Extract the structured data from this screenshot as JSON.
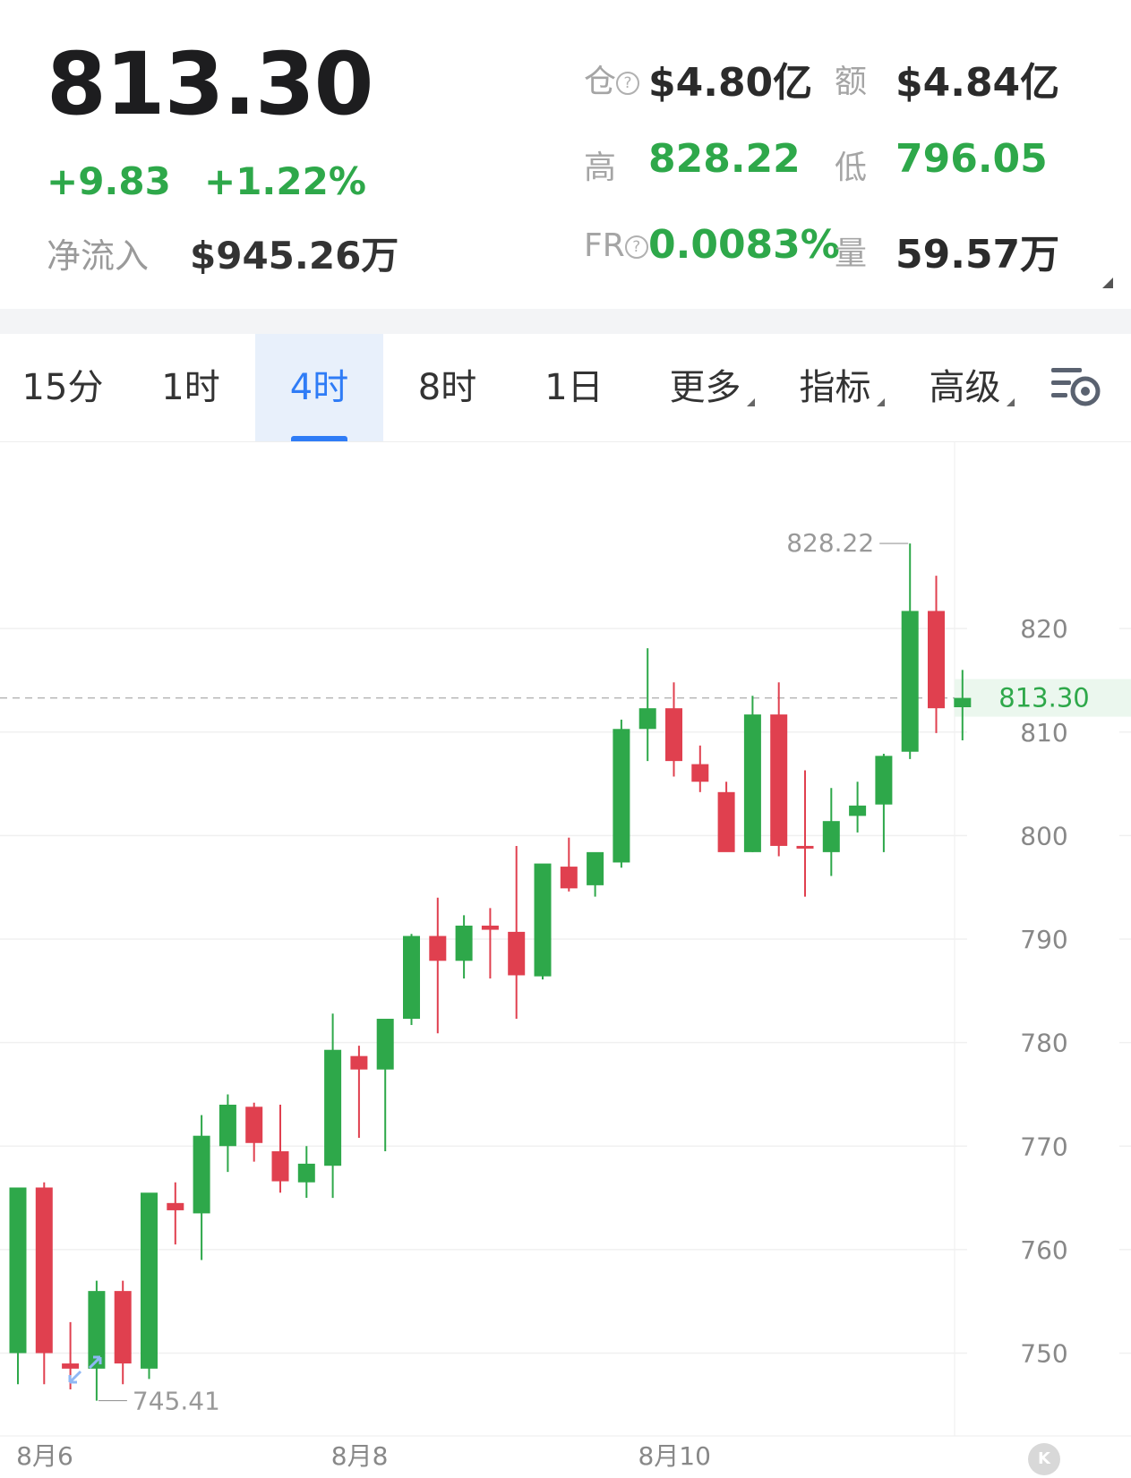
{
  "header": {
    "price": "813.30",
    "change": "+9.83",
    "change_pct": "+1.22%",
    "inflow_label": "净流入",
    "inflow_value": "$945.26万",
    "oi_label": "仓",
    "oi_value": "$4.80亿",
    "amount_label": "额",
    "amount_value": "$4.84亿",
    "high_label": "高",
    "high_value": "828.22",
    "low_label": "低",
    "low_value": "796.05",
    "fr_label": "FR",
    "fr_value": "0.0083%",
    "volume_label": "量",
    "volume_value": "59.57万",
    "help_icon": "question-circle-icon"
  },
  "tabs": [
    {
      "label": "15分",
      "active": false
    },
    {
      "label": "1时",
      "active": false
    },
    {
      "label": "4时",
      "active": true
    },
    {
      "label": "8时",
      "active": false
    },
    {
      "label": "1日",
      "active": false
    },
    {
      "label": "更多",
      "dropdown": true
    },
    {
      "label": "指标",
      "dropdown": true
    },
    {
      "label": "高级",
      "dropdown": true
    }
  ],
  "settings_icon": "chart-settings-icon",
  "colors": {
    "up": "#2ea84a",
    "down": "#e0404f",
    "accent": "#2f7cf6"
  },
  "chart_data": {
    "type": "candlestick",
    "interval": "4时",
    "ylim": [
      742,
      838
    ],
    "yticks": [
      750,
      760,
      770,
      780,
      790,
      800,
      810,
      820
    ],
    "xticks": [
      {
        "label": "8月6",
        "index": 0
      },
      {
        "label": "8月8",
        "index": 12
      },
      {
        "label": "8月10",
        "index": 24
      }
    ],
    "last_price": 813.3,
    "last_price_label": "813.30",
    "max_marker": {
      "label": "828.22",
      "value": 828.22
    },
    "min_marker": {
      "label": "745.41",
      "value": 745.41
    },
    "candles": [
      {
        "o": 750.0,
        "h": 766.0,
        "l": 747.0,
        "c": 766.0
      },
      {
        "o": 766.0,
        "h": 766.5,
        "l": 747.0,
        "c": 750.0
      },
      {
        "o": 749.0,
        "h": 753.0,
        "l": 746.5,
        "c": 748.5
      },
      {
        "o": 748.5,
        "h": 757.0,
        "l": 745.41,
        "c": 756.0
      },
      {
        "o": 756.0,
        "h": 757.0,
        "l": 747.0,
        "c": 749.0
      },
      {
        "o": 748.5,
        "h": 764.0,
        "l": 747.5,
        "c": 765.5
      },
      {
        "o": 764.5,
        "h": 766.5,
        "l": 760.5,
        "c": 763.8
      },
      {
        "o": 763.5,
        "h": 773.0,
        "l": 759.0,
        "c": 771.0
      },
      {
        "o": 770.0,
        "h": 775.0,
        "l": 767.5,
        "c": 774.0
      },
      {
        "o": 773.8,
        "h": 774.2,
        "l": 768.5,
        "c": 770.3
      },
      {
        "o": 769.5,
        "h": 774.0,
        "l": 765.5,
        "c": 766.6
      },
      {
        "o": 766.5,
        "h": 770.0,
        "l": 765.0,
        "c": 768.3
      },
      {
        "o": 768.1,
        "h": 782.8,
        "l": 765.0,
        "c": 779.3
      },
      {
        "o": 778.7,
        "h": 779.7,
        "l": 770.8,
        "c": 777.4
      },
      {
        "o": 777.4,
        "h": 782.2,
        "l": 769.5,
        "c": 782.3
      },
      {
        "o": 782.3,
        "h": 790.5,
        "l": 781.7,
        "c": 790.3
      },
      {
        "o": 790.3,
        "h": 794.0,
        "l": 780.9,
        "c": 787.9
      },
      {
        "o": 787.9,
        "h": 792.3,
        "l": 786.2,
        "c": 791.3
      },
      {
        "o": 791.3,
        "h": 793.0,
        "l": 786.2,
        "c": 790.9
      },
      {
        "o": 790.7,
        "h": 799.0,
        "l": 782.3,
        "c": 786.5
      },
      {
        "o": 786.4,
        "h": 796.5,
        "l": 786.1,
        "c": 797.3
      },
      {
        "o": 797.0,
        "h": 799.8,
        "l": 794.6,
        "c": 794.9
      },
      {
        "o": 795.2,
        "h": 797.3,
        "l": 794.1,
        "c": 798.4
      },
      {
        "o": 797.4,
        "h": 811.2,
        "l": 796.9,
        "c": 810.3
      },
      {
        "o": 810.3,
        "h": 818.1,
        "l": 807.2,
        "c": 812.3
      },
      {
        "o": 812.3,
        "h": 814.8,
        "l": 805.7,
        "c": 807.2
      },
      {
        "o": 806.9,
        "h": 808.7,
        "l": 804.2,
        "c": 805.2
      },
      {
        "o": 804.2,
        "h": 805.2,
        "l": 798.7,
        "c": 798.4
      },
      {
        "o": 798.4,
        "h": 813.5,
        "l": 798.4,
        "c": 811.7
      },
      {
        "o": 811.7,
        "h": 814.8,
        "l": 798.0,
        "c": 799.0
      },
      {
        "o": 799.0,
        "h": 806.3,
        "l": 794.1,
        "c": 798.8
      },
      {
        "o": 798.4,
        "h": 804.6,
        "l": 796.1,
        "c": 801.4
      },
      {
        "o": 801.9,
        "h": 805.2,
        "l": 800.3,
        "c": 802.9
      },
      {
        "o": 803.0,
        "h": 807.9,
        "l": 798.4,
        "c": 807.7
      },
      {
        "o": 808.1,
        "h": 828.22,
        "l": 807.4,
        "c": 821.7
      },
      {
        "o": 821.7,
        "h": 825.1,
        "l": 809.9,
        "c": 812.3
      },
      {
        "o": 812.4,
        "h": 816.0,
        "l": 809.2,
        "c": 813.3
      }
    ]
  }
}
